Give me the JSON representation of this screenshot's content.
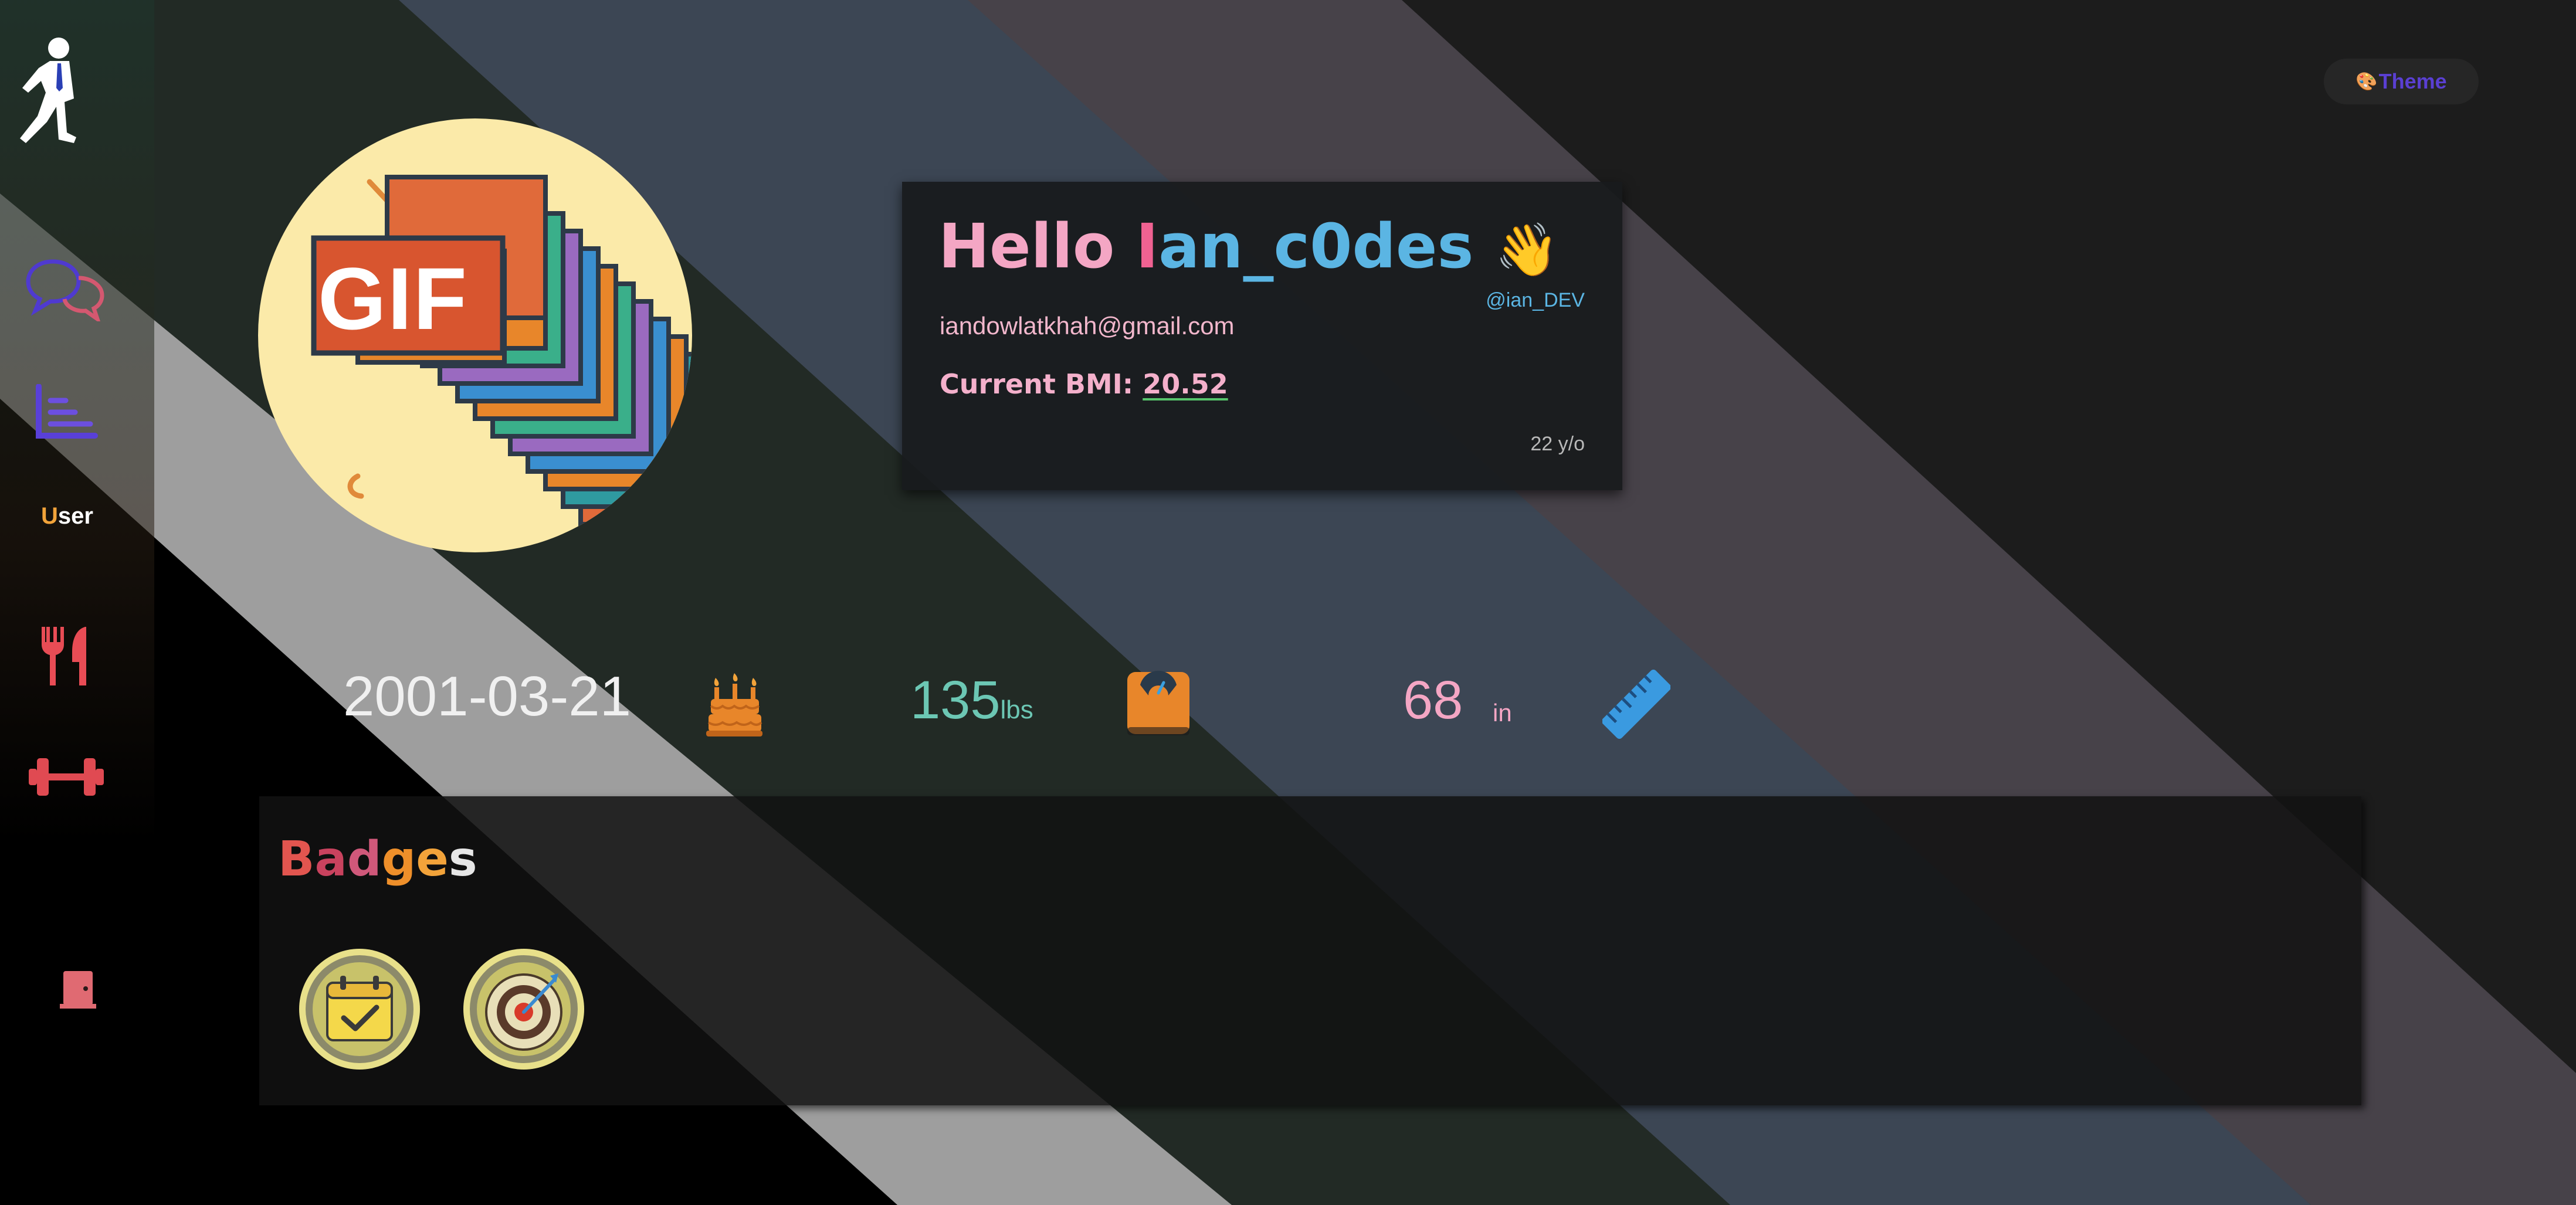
{
  "app": {
    "theme_button": "Theme",
    "theme_icon": "palette-icon"
  },
  "sidebar": {
    "items": [
      {
        "name": "logo",
        "icon": "running-man-icon"
      },
      {
        "name": "chat",
        "icon": "chat-bubbles-icon"
      },
      {
        "name": "stats",
        "icon": "chart-icon"
      },
      {
        "name": "user",
        "label_first": "U",
        "label_rest": "ser"
      },
      {
        "name": "food",
        "icon": "utensils-icon"
      },
      {
        "name": "exercise",
        "icon": "dumbbell-icon"
      },
      {
        "name": "logout",
        "icon": "door-icon"
      }
    ]
  },
  "profile": {
    "avatar_label": "GIF",
    "greeting_word": "Hello",
    "username_first": "I",
    "username_rest": "an_c0des",
    "greeting_emoji": "👋",
    "handle": "@ian_DEV",
    "email": "iandowlatkhah@gmail.com",
    "bmi_label": "Current BMI:",
    "bmi_value": "20.52",
    "age": "22 y/o"
  },
  "stats": {
    "dob": "2001-03-21",
    "dob_icon": "birthday-cake-icon",
    "weight": "135",
    "weight_unit": "lbs",
    "weight_icon": "scale-icon",
    "height": "68",
    "height_unit": "in",
    "height_icon": "ruler-icon"
  },
  "badges": {
    "title_letters": [
      "B",
      "a",
      "d",
      "g",
      "e",
      "s"
    ],
    "title_colors": [
      "#e2554f",
      "#c9425e",
      "#d0587a",
      "#ee8f2a",
      "#f2a33a",
      "#e6e6e6"
    ],
    "items": [
      {
        "name": "calendar-check-badge",
        "icon": "calendar-check-icon"
      },
      {
        "name": "target-badge",
        "icon": "target-icon"
      }
    ]
  }
}
